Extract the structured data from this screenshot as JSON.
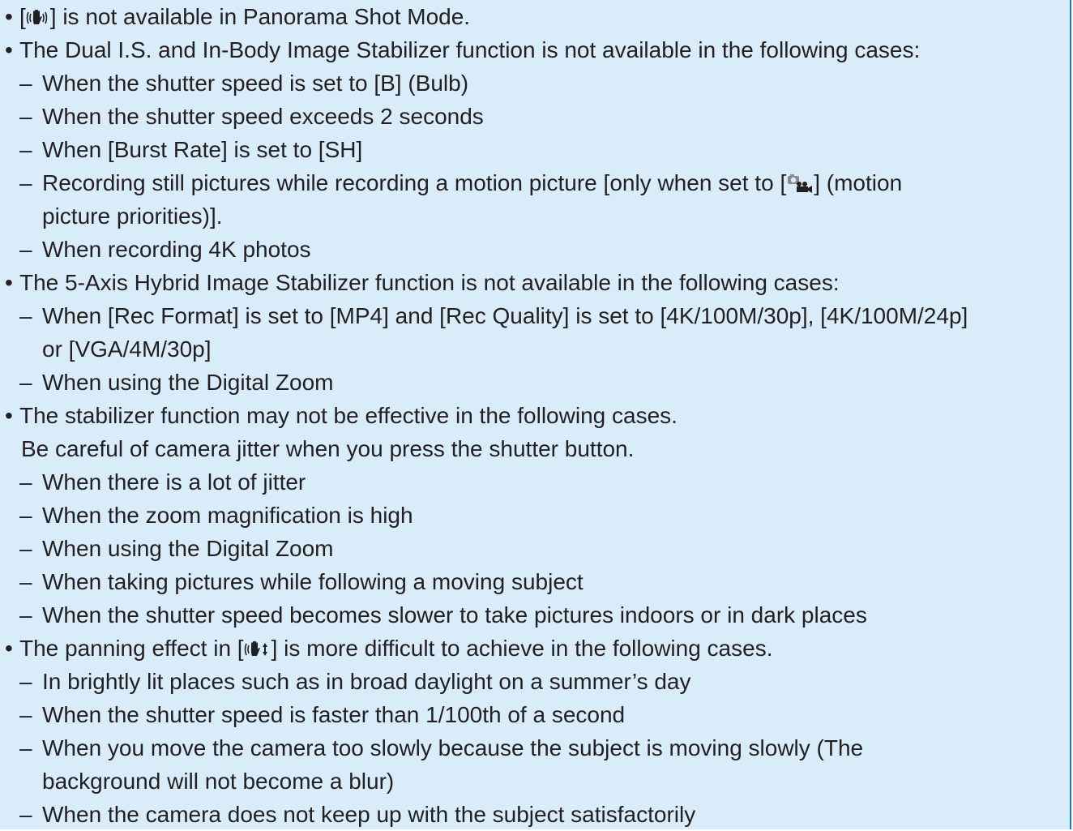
{
  "lines": [
    {
      "kind": "bullet",
      "pre": "[",
      "icon": "stabilizer-hand-icon",
      "post": "] is not available in Panorama Shot Mode."
    },
    {
      "kind": "bullet",
      "text": "The Dual I.S. and In-Body Image Stabilizer function is not available in the following cases:"
    },
    {
      "kind": "dash",
      "text": "When the shutter speed is set to [B] (Bulb)"
    },
    {
      "kind": "dash",
      "text": "When the shutter speed exceeds 2 seconds"
    },
    {
      "kind": "dash",
      "text": "When [Burst Rate] is set to [SH]"
    },
    {
      "kind": "dash",
      "pre": "Recording still pictures while recording a motion picture [only when set to [",
      "icon": "motion-picture-priority-icon",
      "post": "] (motion"
    },
    {
      "kind": "cont",
      "text": "picture priorities)]."
    },
    {
      "kind": "dash",
      "text": "When recording 4K photos"
    },
    {
      "kind": "bullet",
      "text": "The 5-Axis Hybrid Image Stabilizer function is not available in the following cases:"
    },
    {
      "kind": "dash",
      "text": "When [Rec Format] is set to [MP4] and [Rec Quality] is set to [4K/100M/30p], [4K/100M/24p]"
    },
    {
      "kind": "cont",
      "text": "or [VGA/4M/30p]"
    },
    {
      "kind": "dash",
      "text": "When using the Digital Zoom"
    },
    {
      "kind": "bullet",
      "text": "The stabilizer function may not be effective in the following cases."
    },
    {
      "kind": "plain",
      "text": "Be careful of camera jitter when you press the shutter button."
    },
    {
      "kind": "dash",
      "text": "When there is a lot of jitter"
    },
    {
      "kind": "dash",
      "text": "When the zoom magnification is high"
    },
    {
      "kind": "dash",
      "text": "When using the Digital Zoom"
    },
    {
      "kind": "dash",
      "text": "When taking pictures while following a moving subject"
    },
    {
      "kind": "dash",
      "text": "When the shutter speed becomes slower to take pictures indoors or in dark places"
    },
    {
      "kind": "bullet",
      "pre": "The panning effect in [",
      "icon": "stabilizer-vertical-icon",
      "post": "] is more difficult to achieve in the following cases."
    },
    {
      "kind": "dash",
      "text": "In brightly lit places such as in broad daylight on a summer’s day"
    },
    {
      "kind": "dash",
      "text": "When the shutter speed is faster than 1/100th of a second"
    },
    {
      "kind": "dash",
      "text": "When you move the camera too slowly because the subject is moving slowly (The"
    },
    {
      "kind": "cont",
      "text": "background will not become a blur)"
    },
    {
      "kind": "dash",
      "text": "When the camera does not keep up with the subject satisfactorily"
    }
  ],
  "markers": {
    "bullet": "•",
    "dash": "–"
  },
  "colors": {
    "panel_bg": "#d9ecfa",
    "panel_border": "#1b78c8",
    "text": "#231f20"
  }
}
